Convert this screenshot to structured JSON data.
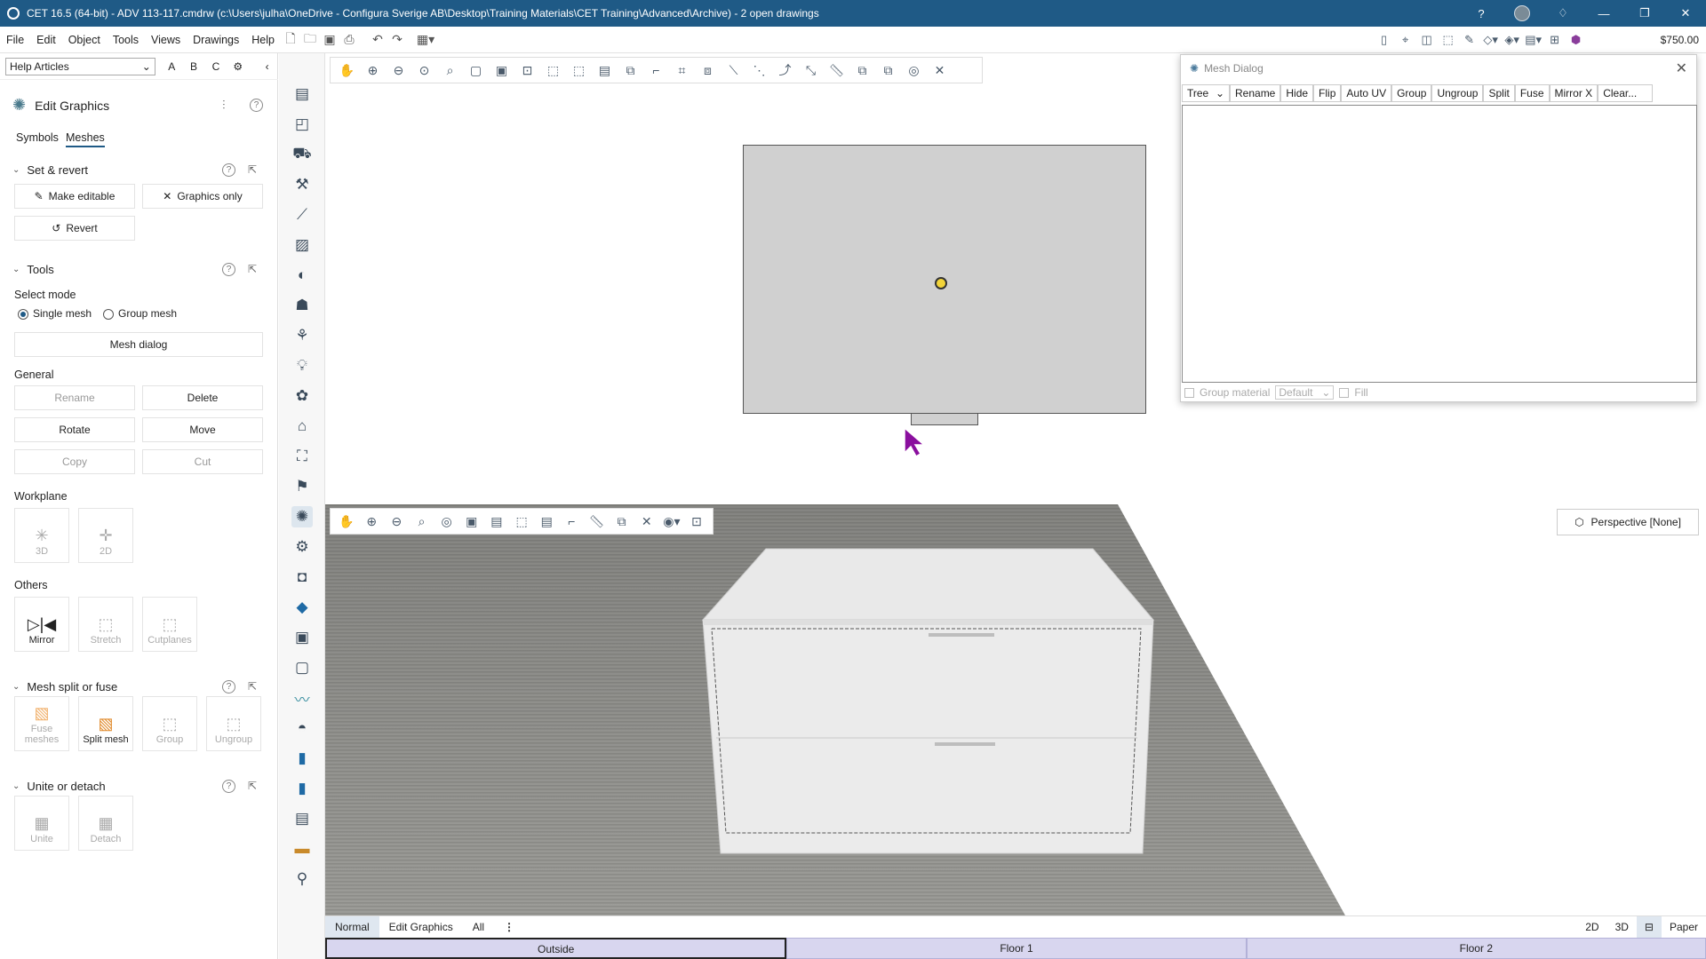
{
  "window": {
    "title": "CET 16.5 (64-bit) - ADV 113-117.cmdrw (c:\\Users\\julha\\OneDrive - Configura Sverige AB\\Desktop\\Training Materials\\CET Training\\Advanced\\Archive) - 2  open drawings",
    "price": "$750.00"
  },
  "menu": {
    "items": [
      "File",
      "Edit",
      "Object",
      "Tools",
      "Views",
      "Drawings",
      "Help"
    ]
  },
  "help": {
    "select": "Help Articles",
    "a": "A",
    "b": "B",
    "c": "C"
  },
  "panel": {
    "title": "Edit Graphics",
    "tabs": [
      "Symbols",
      "Meshes"
    ],
    "set_revert": {
      "title": "Set & revert",
      "make_editable": "Make editable",
      "graphics_only": "Graphics only",
      "revert": "Revert"
    },
    "tools": {
      "title": "Tools",
      "select_mode": "Select mode",
      "single": "Single mesh",
      "group": "Group mesh",
      "mesh_dialog": "Mesh dialog",
      "general": "General",
      "rename": "Rename",
      "delete": "Delete",
      "rotate": "Rotate",
      "move": "Move",
      "copy": "Copy",
      "cut": "Cut",
      "workplane": "Workplane",
      "wp3d": "3D",
      "wp2d": "2D",
      "others": "Others",
      "mirror": "Mirror",
      "stretch": "Stretch",
      "cutplanes": "Cutplanes"
    },
    "split": {
      "title": "Mesh split or fuse",
      "fuse": "Fuse meshes",
      "split": "Split mesh",
      "group": "Group",
      "ungroup": "Ungroup"
    },
    "unite": {
      "title": "Unite or detach",
      "unite": "Unite",
      "detach": "Detach"
    }
  },
  "mesh_dialog": {
    "title": "Mesh Dialog",
    "tree": "Tree",
    "buttons": [
      "Rename",
      "Hide",
      "Flip",
      "Auto UV",
      "Group",
      "Ungroup",
      "Split",
      "Fuse",
      "Mirror X",
      "Clear..."
    ],
    "group_material": "Group material",
    "material": "Default",
    "fill": "Fill"
  },
  "view3d": {
    "perspective": "Perspective [None]"
  },
  "tabs": {
    "items": [
      "Normal",
      "Edit Graphics",
      "All"
    ],
    "right": [
      "2D",
      "3D",
      "Paper"
    ]
  },
  "floors": [
    "Outside",
    "Floor 1",
    "Floor 2"
  ]
}
